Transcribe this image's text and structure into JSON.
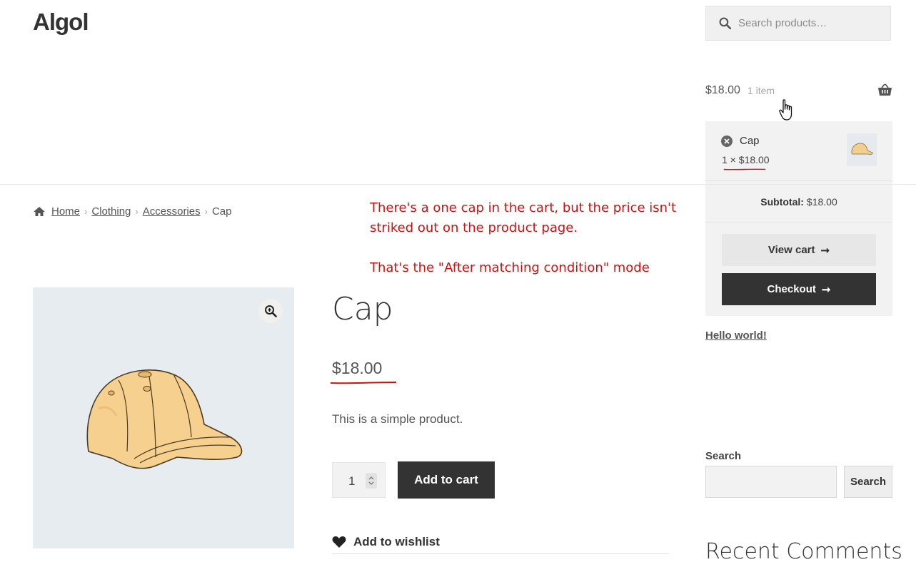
{
  "site": {
    "title": "Algol"
  },
  "header": {
    "search_placeholder": "Search products…",
    "cart_amount": "$18.00",
    "cart_count": "1 item"
  },
  "mini_cart": {
    "item_name": "Cap",
    "item_qty_price": "1 × $18.00",
    "subtotal_label": "Subtotal:",
    "subtotal_value": "$18.00",
    "view_cart_label": "View cart",
    "checkout_label": "Checkout"
  },
  "breadcrumb": {
    "items": [
      "Home",
      "Clothing",
      "Accessories",
      "Cap"
    ]
  },
  "annotation": {
    "line1": "There's a one cap in the cart, but the price isn't",
    "line2": "striked out on the product page.",
    "line3": "That's the \"After matching condition\" mode",
    "color": "#cc1111"
  },
  "product": {
    "title": "Cap",
    "price": "$18.00",
    "description": "This is a simple product.",
    "quantity": "1",
    "add_to_cart_label": "Add to cart",
    "wishlist_label": "Add to wishlist"
  },
  "sidebar": {
    "recent_post": "Hello world!",
    "search_label": "Search",
    "search_button": "Search",
    "recent_comments_title": "Recent Comments"
  },
  "colors": {
    "dark_button": "#333333",
    "image_bg": "#e7ecf1",
    "annotation_red": "#cc1111"
  },
  "icons": [
    "search-icon",
    "basket-icon",
    "hand-cursor-icon",
    "remove-icon",
    "home-icon",
    "zoom-icon",
    "arrow-right-icon",
    "heart-icon"
  ]
}
